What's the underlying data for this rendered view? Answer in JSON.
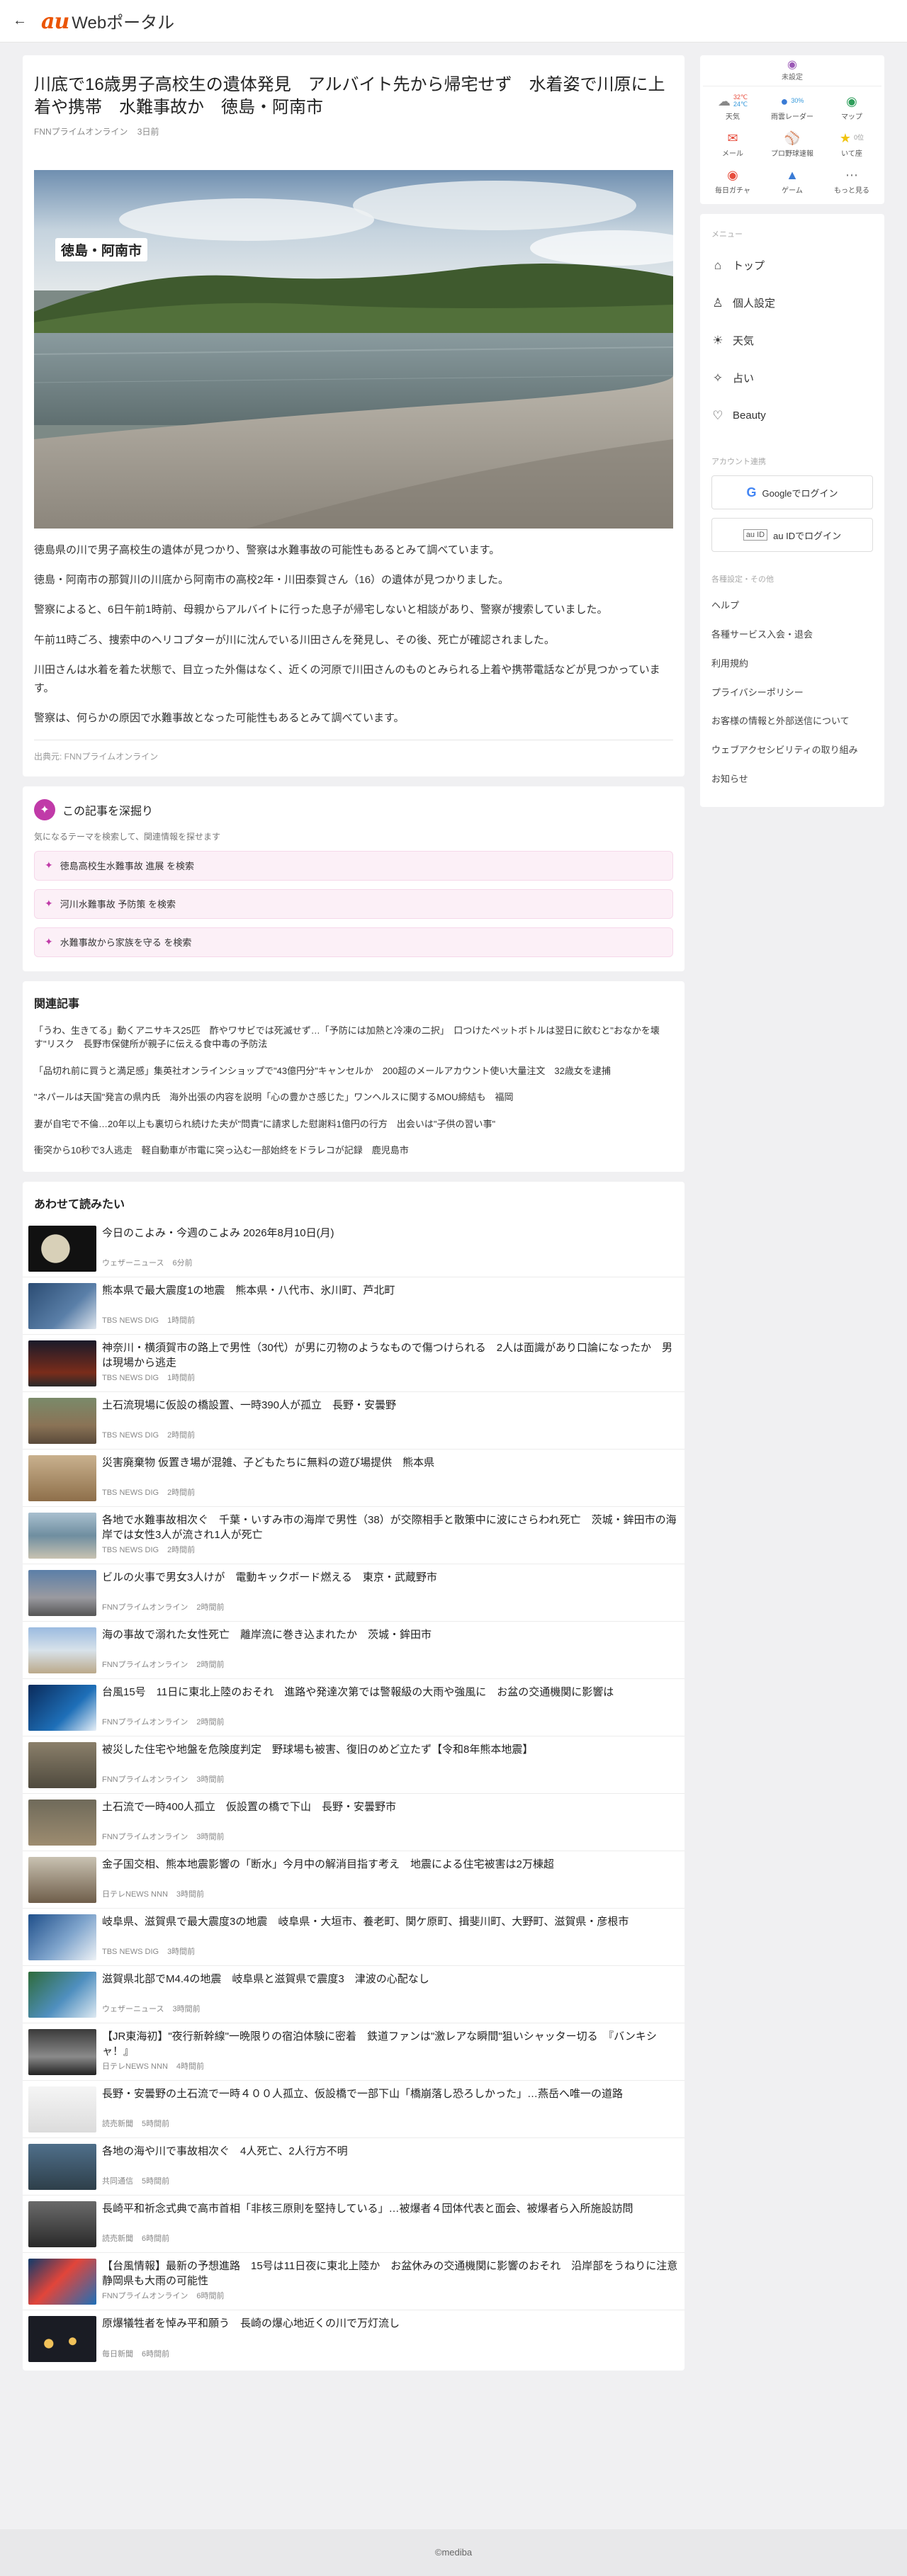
{
  "header": {
    "back_icon": "arrow-left-icon",
    "logo_au": "au",
    "logo_text": "Webポータル"
  },
  "article": {
    "title": "川底で16歳男子高校生の遺体発見　アルバイト先から帰宅せず　水着姿で川原に上着や携帯　水難事故か　徳島・阿南市",
    "source": "FNNプライムオンライン",
    "ago": "3日前",
    "image_caption": "徳島・阿南市",
    "paragraphs": [
      "徳島県の川で男子高校生の遺体が見つかり、警察は水難事故の可能性もあるとみて調べています。",
      "徳島・阿南市の那賀川の川底から阿南市の高校2年・川田泰賀さん（16）の遺体が見つかりました。",
      "警察によると、6日午前1時前、母親からアルバイトに行った息子が帰宅しないと相談があり、警察が捜索していました。",
      "午前11時ごろ、捜索中のヘリコプターが川に沈んでいる川田さんを発見し、その後、死亡が確認されました。",
      "川田さんは水着を着た状態で、目立った外傷はなく、近くの河原で川田さんのものとみられる上着や携帯電話などが見つかっています。",
      "警察は、何らかの原因で水難事故となった可能性もあるとみて調べています。"
    ],
    "credit": "出典元: FNNプライムオンライン"
  },
  "deep_dive": {
    "title": "この記事を深掘り",
    "subtitle": "気になるテーマを検索して、関連情報を探せます",
    "items": [
      "徳島高校生水難事故 進展 を検索",
      "河川水難事故 予防策 を検索",
      "水難事故から家族を守る を検索"
    ]
  },
  "related": {
    "title": "関連記事",
    "items": [
      "「うわ、生きてる」動くアニサキス25匹　酢やワサビでは死滅せず…「予防には加熱と冷凍の二択」　口つけたペットボトルは翌日に飲むと\"おなかを壊す\"リスク　長野市保健所が親子に伝える食中毒の予防法",
      "「品切れ前に買うと満足感」集英社オンラインショップで\"43億円分\"キャンセルか　200超のメールアカウント使い大量注文　32歳女を逮捕",
      "\"ネパールは天国\"発言の県内氏　海外出張の内容を説明「心の豊かさ感じた」ワンヘルスに関するMOU締結も　福岡",
      "妻が自宅で不倫…20年以上も裏切られ続けた夫が\"問責\"に請求した慰謝料1億円の行方　出会いは\"子供の習い事\"",
      "衝突から10秒で3人逃走　軽自動車が市電に突っ込む一部始終をドラレコが記録　鹿児島市"
    ]
  },
  "also_read": {
    "title": "あわせて読みたい",
    "items": [
      {
        "title": "今日のこよみ・今週のこよみ 2026年8月10日(月)",
        "source": "ウェザーニュース",
        "ago": "6分前",
        "thumb": "moon"
      },
      {
        "title": "熊本県で最大震度1の地震　熊本県・八代市、氷川町、芦北町",
        "source": "TBS NEWS DIG",
        "ago": "1時間前",
        "thumb": "map"
      },
      {
        "title": "神奈川・横須賀市の路上で男性（30代）が男に刃物のようなもので傷つけられる　2人は面識があり口論になったか　男は現場から逃走",
        "source": "TBS NEWS DIG",
        "ago": "1時間前",
        "thumb": "night"
      },
      {
        "title": "土石流現場に仮設の橋設置、一時390人が孤立　長野・安曇野",
        "source": "TBS NEWS DIG",
        "ago": "2時間前",
        "thumb": "mud"
      },
      {
        "title": "災害廃棄物 仮置き場が混雑、子どもたちに無料の遊び場提供　熊本県",
        "source": "TBS NEWS DIG",
        "ago": "2時間前",
        "thumb": "debris"
      },
      {
        "title": "各地で水難事故相次ぐ　千葉・いすみ市の海岸で男性（38）が交際相手と散策中に波にさらわれ死亡　茨城・鉾田市の海岸では女性3人が流され1人が死亡",
        "source": "TBS NEWS DIG",
        "ago": "2時間前",
        "thumb": "sea"
      },
      {
        "title": "ビルの火事で男女3人けが　電動キックボード燃える　東京・武蔵野市",
        "source": "FNNプライムオンライン",
        "ago": "2時間前",
        "thumb": "street"
      },
      {
        "title": "海の事故で溺れた女性死亡　離岸流に巻き込まれたか　茨城・鉾田市",
        "source": "FNNプライムオンライン",
        "ago": "2時間前",
        "thumb": "beach"
      },
      {
        "title": "台風15号　11日に東北上陸のおそれ　進路や発達次第では警報級の大雨や強風に　お盆の交通機関に影響は",
        "source": "FNNプライムオンライン",
        "ago": "2時間前",
        "thumb": "typhoon"
      },
      {
        "title": "被災した住宅や地盤を危険度判定　野球場も被害、復旧のめど立たず【令和8年熊本地震】",
        "source": "FNNプライムオンライン",
        "ago": "3時間前",
        "thumb": "ground"
      },
      {
        "title": "土石流で一時400人孤立　仮設置の橋で下山　長野・安曇野市",
        "source": "FNNプライムオンライン",
        "ago": "3時間前",
        "thumb": "mud2"
      },
      {
        "title": "金子国交相、熊本地震影響の「断水」今月中の解消目指す考え　地震による住宅被害は2万棟超",
        "source": "日テレNEWS NNN",
        "ago": "3時間前",
        "thumb": "minister"
      },
      {
        "title": "岐阜県、滋賀県で最大震度3の地震　岐阜県・大垣市、養老町、関ケ原町、揖斐川町、大野町、滋賀県・彦根市",
        "source": "TBS NEWS DIG",
        "ago": "3時間前",
        "thumb": "map2"
      },
      {
        "title": "滋賀県北部でM4.4の地震　岐阜県と滋賀県で震度3　津波の心配なし",
        "source": "ウェザーニュース",
        "ago": "3時間前",
        "thumb": "quakemap"
      },
      {
        "title": "【JR東海初】\"夜行新幹線\"一晩限りの宿泊体験に密着　鉄道ファンは\"激レアな瞬間\"狙いシャッター切る　『バンキシャ！』",
        "source": "日テレNEWS NNN",
        "ago": "4時間前",
        "thumb": "train"
      },
      {
        "title": "長野・安曇野の土石流で一時４００人孤立、仮設橋で一部下山「橋崩落し恐ろしかった」…燕岳へ唯一の道路",
        "source": "読売新聞",
        "ago": "5時間前",
        "thumb": "diagram"
      },
      {
        "title": "各地の海や川で事故相次ぐ　4人死亡、2人行方不明",
        "source": "共同通信",
        "ago": "5時間前",
        "thumb": "river"
      },
      {
        "title": "長崎平和祈念式典で高市首相「非核三原則を堅持している」…被爆者４団体代表と面会、被爆者ら入所施設訪問",
        "source": "読売新聞",
        "ago": "6時間前",
        "thumb": "pm"
      },
      {
        "title": "【台風情報】最新の予想進路　15号は11日夜に東北上陸か　お盆休みの交通機関に影響のおそれ　沿岸部をうねりに注意　静岡県も大雨の可能性",
        "source": "FNNプライムオンライン",
        "ago": "6時間前",
        "thumb": "typhoon2"
      },
      {
        "title": "原爆犠牲者を悼み平和願う　長崎の爆心地近くの川で万灯流し",
        "source": "毎日新聞",
        "ago": "6時間前",
        "thumb": "lanterns"
      }
    ]
  },
  "sidebar": {
    "location_label": "未設定",
    "weather_high": "32℃",
    "weather_low": "24℃",
    "rain_percent": "30%",
    "quick_items": [
      {
        "label": "天気",
        "icon": "weather-icon"
      },
      {
        "label": "雨雲レーダー",
        "icon": "radar-icon"
      },
      {
        "label": "マップ",
        "icon": "map-icon"
      },
      {
        "label": "メール",
        "icon": "mail-icon"
      },
      {
        "label": "プロ野球速報",
        "icon": "baseball-icon"
      },
      {
        "label": "いて座",
        "icon": "horoscope-icon"
      },
      {
        "label": "毎日ガチャ",
        "icon": "gacha-icon"
      },
      {
        "label": "ゲーム",
        "icon": "game-icon"
      },
      {
        "label": "もっと見る",
        "icon": "more-icon"
      }
    ],
    "horoscope_value": "0位",
    "menu_label": "メニュー",
    "menu_items": [
      {
        "label": "トップ",
        "icon": "home-icon",
        "glyph": "⌂"
      },
      {
        "label": "個人設定",
        "icon": "user-icon",
        "glyph": "♙"
      },
      {
        "label": "天気",
        "icon": "sun-icon",
        "glyph": "☀"
      },
      {
        "label": "占い",
        "icon": "sparkle-icon",
        "glyph": "✧"
      },
      {
        "label": "Beauty",
        "icon": "heart-icon",
        "glyph": "♡"
      }
    ],
    "account_label": "アカウント連携",
    "google_login": "Googleでログイン",
    "auid_login": "au IDでログイン",
    "auid_badge": "au ID",
    "settings_label": "各種設定・その他",
    "links": [
      "ヘルプ",
      "各種サービス入会・退会",
      "利用規約",
      "プライバシーポリシー",
      "お客様の情報と外部送信について",
      "ウェブアクセシビリティの取り組み",
      "お知らせ"
    ]
  },
  "footer": {
    "copyright": "©mediba"
  }
}
